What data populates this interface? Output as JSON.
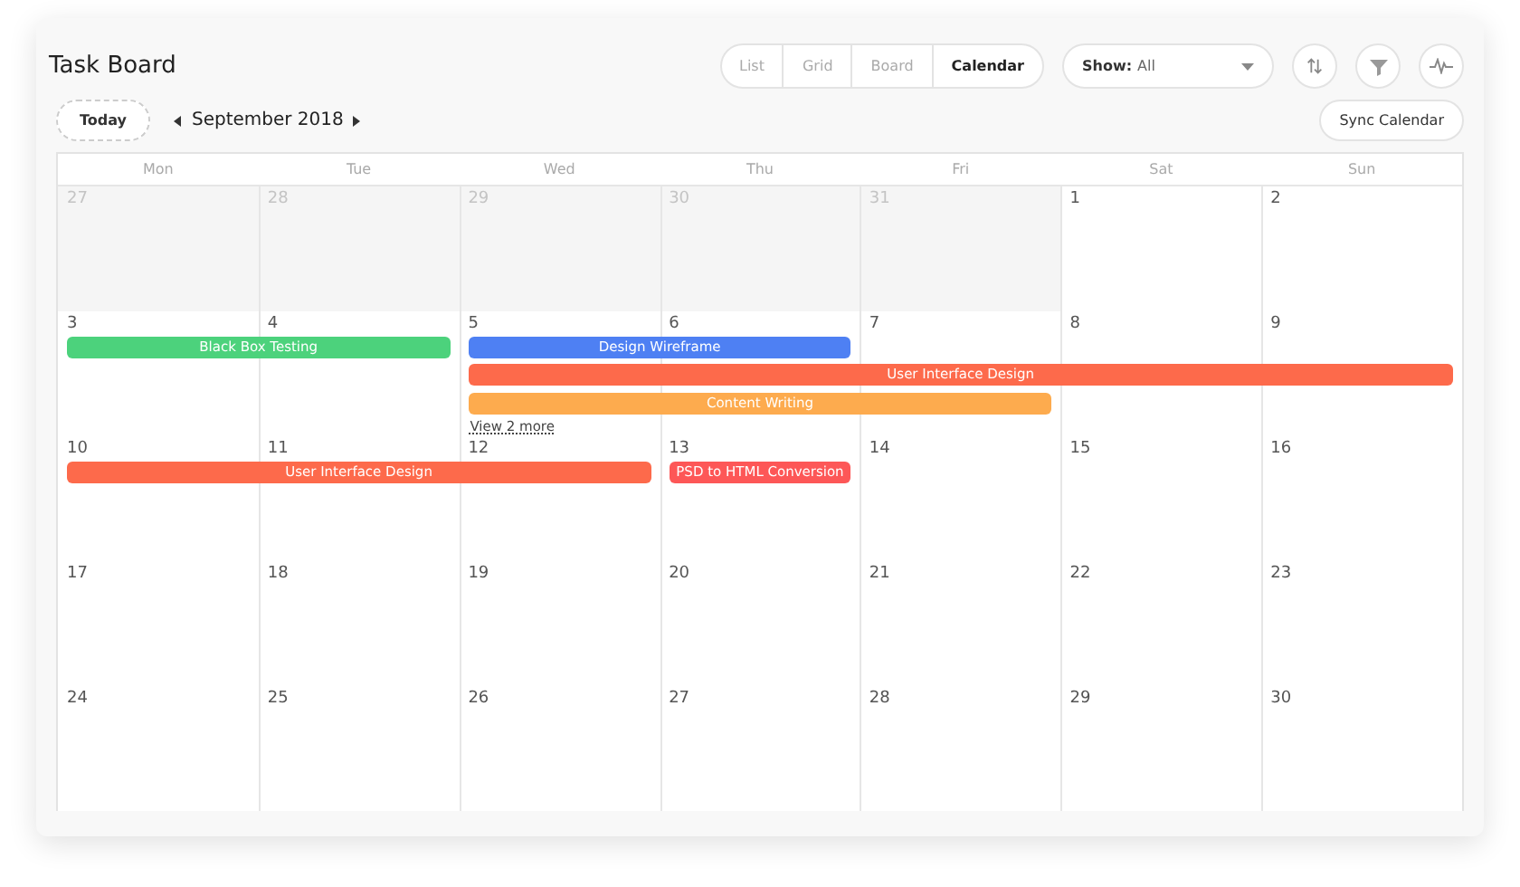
{
  "title": "Task Board",
  "views": [
    {
      "label": "List",
      "selected": false
    },
    {
      "label": "Grid",
      "selected": false
    },
    {
      "label": "Board",
      "selected": false
    },
    {
      "label": "Calendar",
      "selected": true
    }
  ],
  "show_filter": {
    "label": "Show:",
    "value": "All"
  },
  "today_button": "Today",
  "month": "September 2018",
  "sync_button": "Sync Calendar",
  "weekdays": [
    "Mon",
    "Tue",
    "Wed",
    "Thu",
    "Fri",
    "Sat",
    "Sun"
  ],
  "weeks": [
    {
      "days": [
        {
          "date": "27",
          "outside": true
        },
        {
          "date": "28",
          "outside": true
        },
        {
          "date": "29",
          "outside": true
        },
        {
          "date": "30",
          "outside": true
        },
        {
          "date": "31",
          "outside": true
        },
        {
          "date": "1",
          "outside": false
        },
        {
          "date": "2",
          "outside": false
        }
      ]
    },
    {
      "days": [
        {
          "date": "3",
          "outside": false,
          "bars": [
            {
              "kind": "start",
              "title": "Black Box Testing",
              "color": "#4cd27c"
            }
          ]
        },
        {
          "date": "4",
          "outside": false,
          "bars": [
            {
              "kind": "continue"
            }
          ]
        },
        {
          "date": "5",
          "outside": false,
          "bars": [
            {
              "kind": "start",
              "title": "Design Wireframe",
              "color": "#4e80f3"
            },
            {
              "kind": "start",
              "title": "User Interface Design",
              "color": "#fd6a4b"
            },
            {
              "kind": "start",
              "title": "Content Writing",
              "color": "#fdab4e"
            }
          ],
          "more": "View 2 more"
        },
        {
          "date": "6",
          "outside": false,
          "bars": [
            {
              "kind": "continue"
            },
            {
              "kind": "continue"
            },
            {
              "kind": "continue"
            }
          ]
        },
        {
          "date": "7",
          "outside": false,
          "bars": [
            {
              "kind": "empty"
            },
            {
              "kind": "continue"
            },
            {
              "kind": "continue"
            }
          ]
        },
        {
          "date": "8",
          "outside": false,
          "bars": [
            {
              "kind": "empty"
            },
            {
              "kind": "continue"
            }
          ]
        },
        {
          "date": "9",
          "outside": false,
          "bars": [
            {
              "kind": "empty"
            },
            {
              "kind": "continue"
            }
          ]
        }
      ]
    },
    {
      "days": [
        {
          "date": "10",
          "outside": false,
          "bars": [
            {
              "kind": "start",
              "title": "User Interface Design",
              "color": "#fd6a4b"
            }
          ]
        },
        {
          "date": "11",
          "outside": false,
          "bars": [
            {
              "kind": "continue"
            }
          ]
        },
        {
          "date": "12",
          "outside": false,
          "bars": [
            {
              "kind": "continue"
            }
          ]
        },
        {
          "date": "13",
          "outside": false,
          "bars": [
            {
              "kind": "start",
              "title": "PSD to HTML Conversion",
              "color": "#fd5757"
            }
          ]
        },
        {
          "date": "14",
          "outside": false
        },
        {
          "date": "15",
          "outside": false
        },
        {
          "date": "16",
          "outside": false
        }
      ]
    },
    {
      "days": [
        {
          "date": "17",
          "outside": false
        },
        {
          "date": "18",
          "outside": false
        },
        {
          "date": "19",
          "outside": false
        },
        {
          "date": "20",
          "outside": false
        },
        {
          "date": "21",
          "outside": false
        },
        {
          "date": "22",
          "outside": false
        },
        {
          "date": "23",
          "outside": false
        }
      ]
    },
    {
      "days": [
        {
          "date": "24",
          "outside": false
        },
        {
          "date": "25",
          "outside": false
        },
        {
          "date": "26",
          "outside": false
        },
        {
          "date": "27",
          "outside": false
        },
        {
          "date": "28",
          "outside": false
        },
        {
          "date": "29",
          "outside": false
        },
        {
          "date": "30",
          "outside": false
        }
      ]
    }
  ]
}
